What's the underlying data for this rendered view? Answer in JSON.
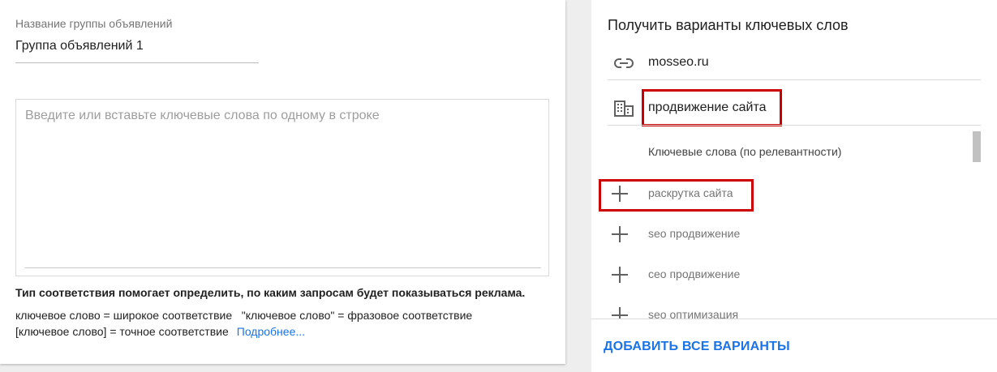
{
  "left": {
    "group_label": "Название группы объявлений",
    "group_value": "Группа объявлений 1",
    "keywords_placeholder": "Введите или вставьте ключевые слова по одному в строке",
    "match_title": "Тип соответствия помогает определить, по каким запросам будет показываться реклама.",
    "match_line1": "ключевое слово = широкое соответствие   \"ключевое слово\" = фразовое соответствие",
    "match_line2": "[ключевое слово] = точное соответствие",
    "more_link": "Подробнее..."
  },
  "right": {
    "title": "Получить варианты ключевых слов",
    "url_value": "mosseo.ru",
    "url_icon": "link-icon",
    "product_value": "продвижение сайта",
    "product_icon": "building-icon",
    "column_header": "Ключевые слова (по релевантности)",
    "suggestions": [
      {
        "label": "раскрутка сайта",
        "icon": "plus-icon"
      },
      {
        "label": "seo продвижение",
        "icon": "plus-icon"
      },
      {
        "label": "сео продвижение",
        "icon": "plus-icon"
      },
      {
        "label": "seo оптимизация",
        "icon": "plus-icon"
      }
    ],
    "add_all": "ДОБАВИТЬ ВСЕ ВАРИАНТЫ"
  },
  "colors": {
    "accent": "#1a73e8",
    "highlight": "#cc0000",
    "background": "#eeeeee"
  }
}
